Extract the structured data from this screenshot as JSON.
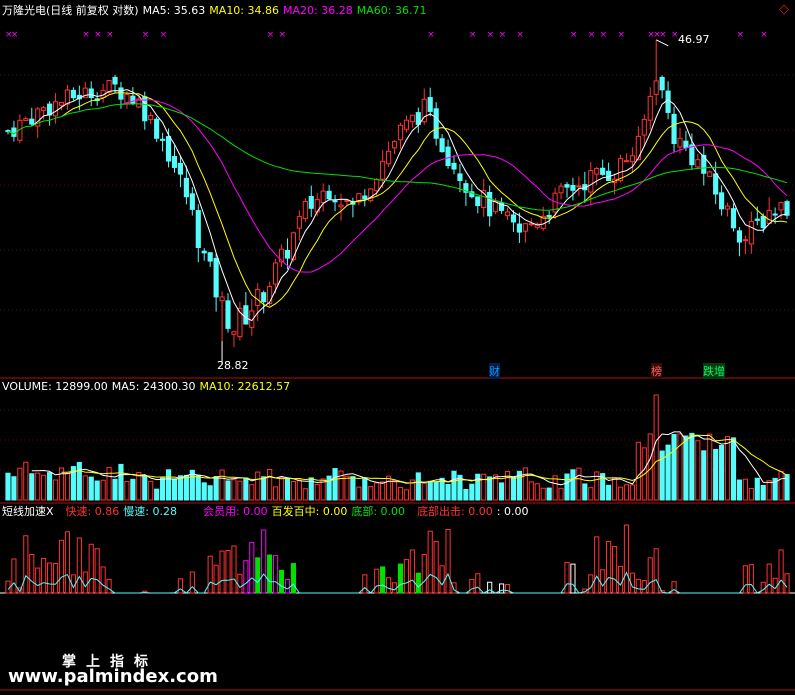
{
  "header": {
    "stock": "万隆光电(日线 前复权 对数)",
    "ma5": "MA5: 35.63",
    "ma10": "MA10: 34.86",
    "ma20": "MA20: 36.28",
    "ma60": "MA60: 36.71"
  },
  "vol_header": {
    "label": "VOLUME: 12899.00",
    "ma5": "MA5: 24300.30",
    "ma10": "MA10: 22612.57"
  },
  "ind_header": {
    "name": "短线加速X",
    "fast": "快速: 0.86",
    "slow": "慢速: 0.28",
    "member": "会员用: 0.00",
    "hit": "百发百中: 0.00",
    "bottom": "底部: 0.00",
    "bottom_out": "底部出击: 0.00",
    "blank": ": 0.00"
  },
  "annotations": {
    "high": "46.97",
    "low": "28.82",
    "cai": "财",
    "bang": "榜",
    "dieng": "跌增"
  },
  "watermark": {
    "main": "掌上指标",
    "url": "www.palmindex.com"
  },
  "colors": {
    "up": "#ff3232",
    "down": "#54fcfc",
    "ma5": "#ffffff",
    "ma10": "#ffff00",
    "ma20": "#ff00ff",
    "ma60": "#00e000",
    "fast": "#ff3232",
    "slow": "#54fcfc",
    "member": "#ff00ff",
    "hit": "#ffff00",
    "bottom_color": "#00e000",
    "axis": "#b01010"
  },
  "chart_data": {
    "type": "candlestick",
    "count": 132,
    "price_range": [
      27.5,
      48.5
    ],
    "candles": [],
    "volume": [],
    "indicator": []
  }
}
